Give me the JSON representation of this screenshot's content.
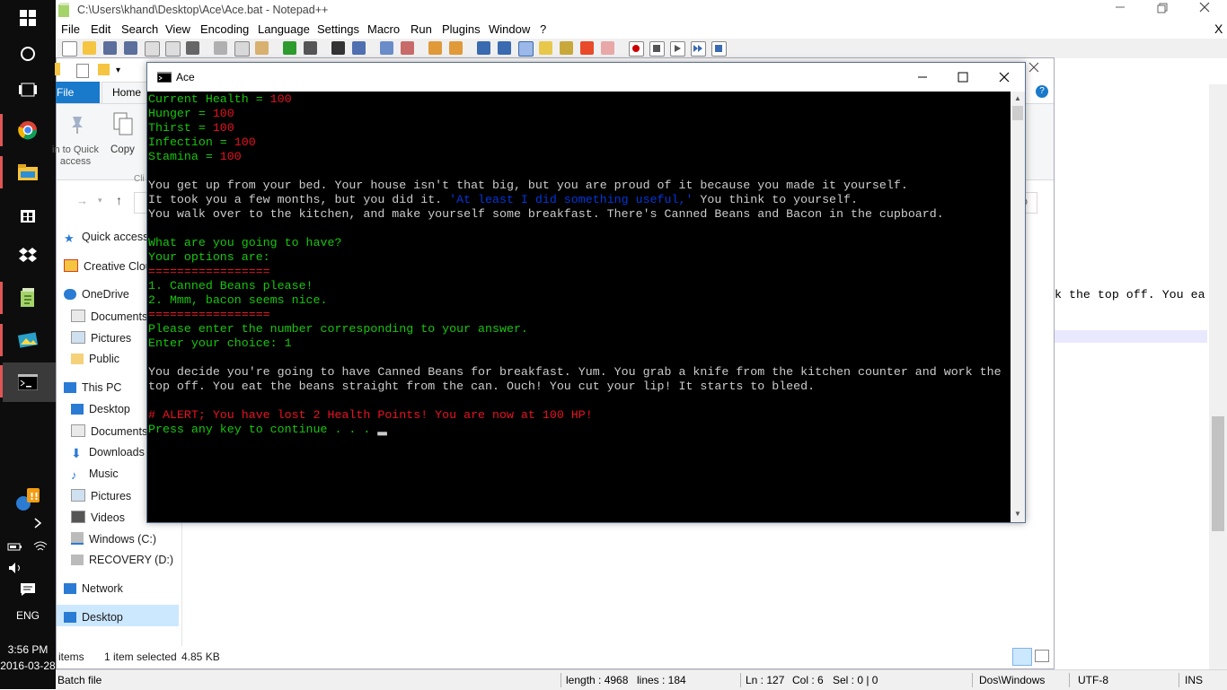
{
  "notepad": {
    "title": "C:\\Users\\khand\\Desktop\\Ace\\Ace.bat - Notepad++",
    "menu": [
      "File",
      "Edit",
      "Search",
      "View",
      "Encoding",
      "Language",
      "Settings",
      "Macro",
      "Run",
      "Plugins",
      "Window",
      "?"
    ],
    "close_x": "X",
    "right_text": "k the top off. You ea",
    "status": {
      "type": "Batch file",
      "length": "length : 4968",
      "lines": "lines : 184",
      "ln": "Ln : 127",
      "col": "Col : 6",
      "sel": "Sel : 0 | 0",
      "eol": "Dos\\Windows",
      "encoding": "UTF-8",
      "mode": "INS"
    }
  },
  "taskbar": {
    "language": "ENG",
    "time": "3:56 PM",
    "date": "2016-03-28"
  },
  "explorer": {
    "tab_file": "File",
    "tab_home": "Home",
    "pin_label": "in to Quick access",
    "copy_label": "Copy",
    "clip_label": "Cli",
    "nav": [
      "Quick access",
      "Creative Cloud",
      "OneDrive",
      "Documents",
      "Pictures",
      "Public",
      "This PC",
      "Desktop",
      "Documents",
      "Downloads",
      "Music",
      "Pictures",
      "Videos",
      "Windows (C:)",
      "RECOVERY (D:)",
      "Network",
      "Desktop"
    ],
    "status_items": "items",
    "status_selected": "1 item selected",
    "status_size": "4.85 KB"
  },
  "cmd": {
    "title": "Ace",
    "lines": [
      {
        "t": "Current Health = ",
        "c": "g",
        "v": "100"
      },
      {
        "t": "Hunger = ",
        "c": "g",
        "v": "100"
      },
      {
        "t": "Thirst = ",
        "c": "g",
        "v": "100"
      },
      {
        "t": "Infection = ",
        "c": "g",
        "v": "100"
      },
      {
        "t": "Stamina = ",
        "c": "g",
        "v": "100"
      }
    ],
    "story1": "You get up from your bed. Your house isn't that big, but you are proud of it because you made it yourself.",
    "story2a": "It took you a few months, but you did it. ",
    "story2b": "'At least I did something useful,'",
    "story2c": " You think to yourself.",
    "story3": "You walk over to the kitchen, and make yourself some breakfast. There's Canned Beans and Bacon in the cupboard.",
    "q1": "What are you going to have?",
    "q2": "Your options are:",
    "sep": "=================",
    "opt1": "1. Canned Beans please!",
    "opt2": "2. Mmm, bacon seems nice.",
    "prompt1": "Please enter the number corresponding to your answer.",
    "prompt2": "Enter your choice: 1",
    "res1": "You decide you're going to have Canned Beans for breakfast. Yum. You grab a knife from the kitchen counter and work the",
    "res2": "top off. You eat the beans straight from the can. Ouch! You cut your lip! It starts to bleed.",
    "alert": "# ALERT; You have lost 2 Health Points! You are now at 100 HP!",
    "cont": "Press any key to continue . . . "
  }
}
